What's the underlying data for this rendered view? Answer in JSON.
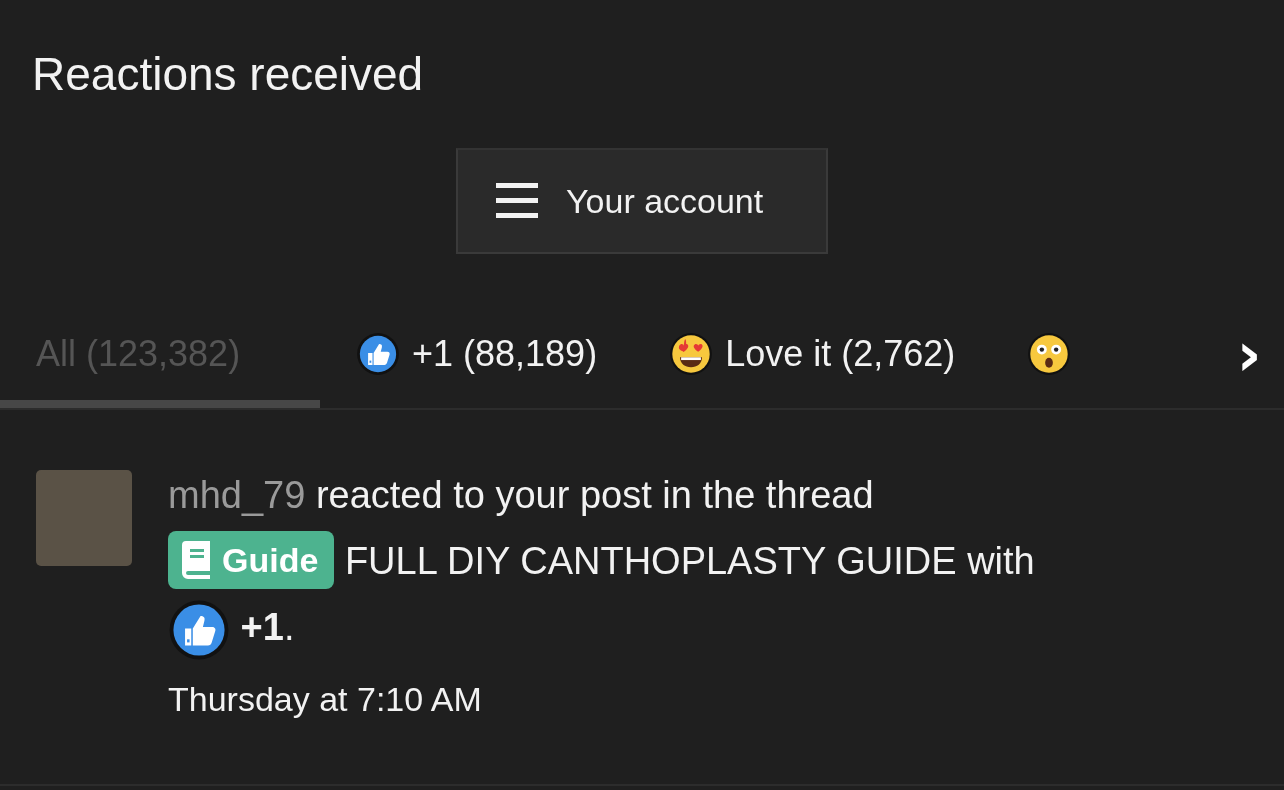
{
  "page": {
    "title": "Reactions received"
  },
  "account_button": {
    "label": "Your account"
  },
  "tabs": [
    {
      "label": "All (123,382)",
      "kind": "plain",
      "selected": true
    },
    {
      "label": "+1 (88,189)",
      "kind": "like",
      "selected": false
    },
    {
      "label": "Love it (2,762)",
      "kind": "love",
      "selected": false
    },
    {
      "kind": "wow",
      "selected": false
    }
  ],
  "tabs_next": {
    "symbol": "›"
  },
  "reactions": [
    {
      "user": "mhd_79",
      "text": "reacted to your post in the thread",
      "prefix": "Guide",
      "thread": "FULL DIY CANTHOPLASTY GUIDE",
      "with": "with",
      "reaction": "**+1**.",
      "kind": "like",
      "time": "Thursday at 7:10 AM"
    }
  ]
}
